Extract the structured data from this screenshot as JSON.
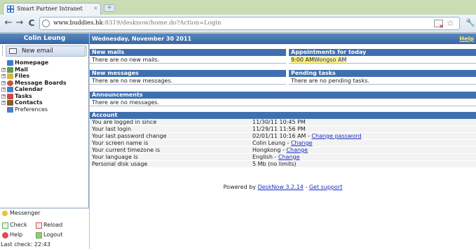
{
  "browser": {
    "tab_title": "Smart Partner Intranet",
    "tab_close": "×",
    "new_tab": "+",
    "url_host": "www.buddies.hk",
    "url_rest": ":8319/desknow/home.do?Action=Login"
  },
  "sidebar": {
    "user_name": "Colin Leung",
    "new_email_label": "New email",
    "tree": [
      {
        "label": "Homepage",
        "expandable": false,
        "bold": true,
        "icon": "home-icon",
        "color": "#3a7bd5"
      },
      {
        "label": "Mail",
        "expandable": true,
        "bold": true,
        "icon": "mail-icon",
        "color": "#5c9e4a"
      },
      {
        "label": "Files",
        "expandable": true,
        "bold": true,
        "icon": "files-icon",
        "color": "#d9b447"
      },
      {
        "label": "Message Boards",
        "expandable": true,
        "bold": true,
        "icon": "message-boards-icon",
        "color": "#c9533a"
      },
      {
        "label": "Calendar",
        "expandable": true,
        "bold": true,
        "icon": "calendar-icon",
        "color": "#4a7fc2"
      },
      {
        "label": "Tasks",
        "expandable": true,
        "bold": true,
        "icon": "tasks-icon",
        "color": "#d04848"
      },
      {
        "label": "Contacts",
        "expandable": true,
        "bold": true,
        "icon": "contacts-icon",
        "color": "#8a5a2a"
      },
      {
        "label": "Preferences",
        "expandable": false,
        "bold": false,
        "icon": "preferences-icon",
        "color": "#4a7fc2"
      }
    ],
    "messenger": {
      "title": "Messenger",
      "check": "Check",
      "reload": "Reload",
      "help": "Help",
      "logout": "Logout",
      "last_check": "Last check: 22:43"
    }
  },
  "main": {
    "date": "Wednesday, November 30 2011",
    "help": "Help",
    "new_mails": {
      "title": "New mails",
      "text": "There are no new mails."
    },
    "appointments": {
      "title": "Appointments for today",
      "time": "9:00 AM",
      "name": "Wongso AM"
    },
    "new_messages": {
      "title": "New messages",
      "text": "There are no new messages."
    },
    "pending_tasks": {
      "title": "Pending tasks",
      "text": "There are no pending tasks."
    },
    "announcements": {
      "title": "Announcements",
      "text": "There are no messages."
    },
    "account": {
      "title": "Account",
      "rows": [
        {
          "label": "You are logged in since",
          "value": "11/30/11 10:45 PM",
          "link": ""
        },
        {
          "label": "Your last login",
          "value": "11/29/11 11:56 PM",
          "link": ""
        },
        {
          "label": "Your last password change",
          "value": "02/01/11 10:16 AM - ",
          "link": "Change password"
        },
        {
          "label": "Your screen name is",
          "value": "Colin Leung - ",
          "link": "Change"
        },
        {
          "label": "Your current timezone is",
          "value": "Hongkong - ",
          "link": "Change"
        },
        {
          "label": "Your language is",
          "value": "English - ",
          "link": "Change"
        },
        {
          "label": "Personal disk usage",
          "value": "5 Mb (no limits)",
          "link": ""
        }
      ]
    },
    "footer": {
      "prefix": "Powered by ",
      "product": "DeskNow 3.2.14",
      "sep": " - ",
      "support": "Get support"
    }
  }
}
